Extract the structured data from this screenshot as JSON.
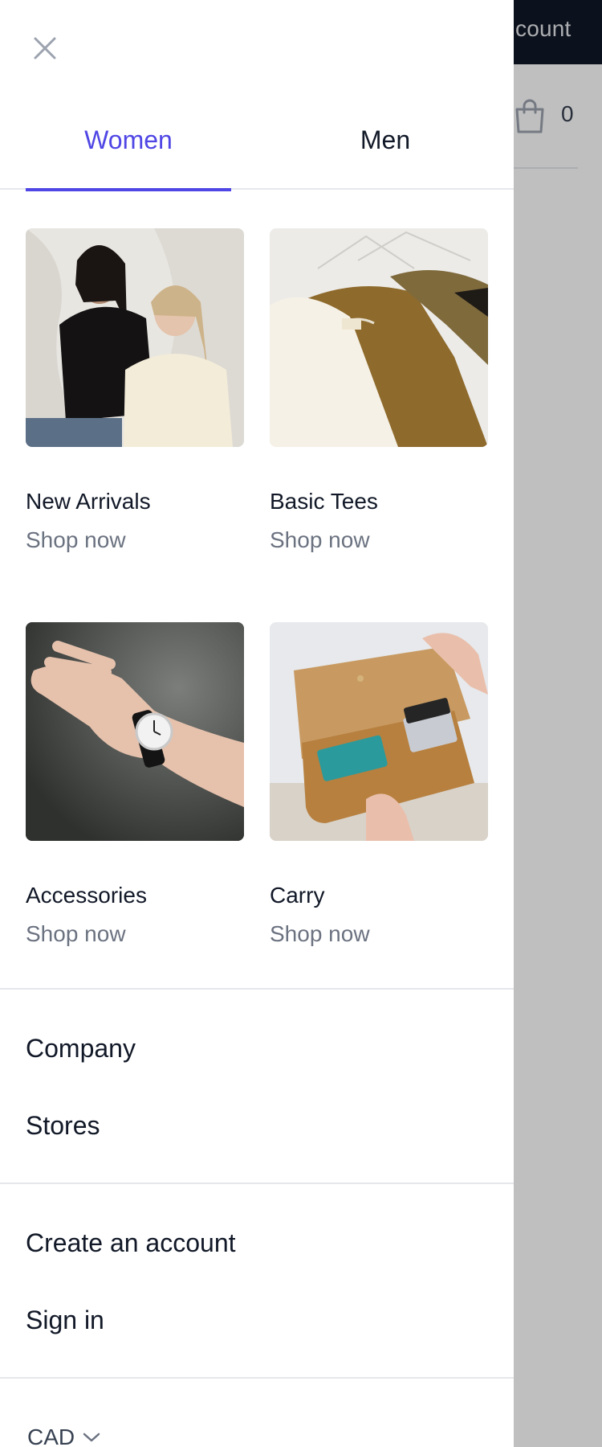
{
  "background": {
    "account_text": "count",
    "cart_count": "0"
  },
  "drawer": {
    "tabs": [
      {
        "label": "Women",
        "active": true
      },
      {
        "label": "Men",
        "active": false
      }
    ],
    "cards": [
      {
        "title": "New Arrivals",
        "cta": "Shop now",
        "image": "two-women-tees-photo"
      },
      {
        "title": "Basic Tees",
        "cta": "Shop now",
        "image": "tees-on-hangers-photo"
      },
      {
        "title": "Accessories",
        "cta": "Shop now",
        "image": "wrist-watch-photo"
      },
      {
        "title": "Carry",
        "cta": "Shop now",
        "image": "leather-wallet-photo"
      }
    ],
    "pages": [
      "Company",
      "Stores"
    ],
    "account": [
      "Create an account",
      "Sign in"
    ],
    "currency": "CAD"
  },
  "colors": {
    "accent": "#4f46e5",
    "topbar": "#111827",
    "muted": "#6b7280"
  }
}
